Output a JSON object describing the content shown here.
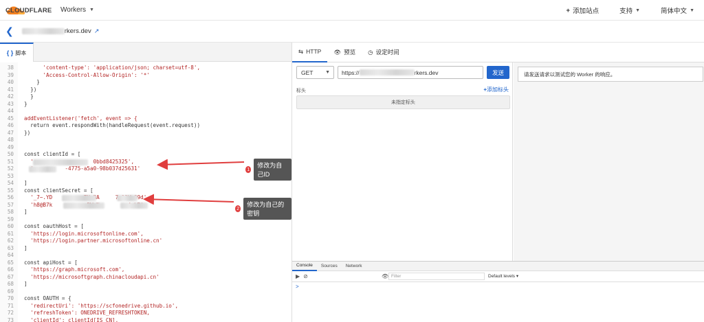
{
  "topbar": {
    "logo_text": "CLOUDFLARE",
    "product_menu": "Workers",
    "add_site": "添加站点",
    "support": "支持",
    "language": "简体中文"
  },
  "subbar": {
    "domain_suffix": "rkers.dev"
  },
  "editor": {
    "tab_label": "脚本",
    "lines": [
      {
        "n": "38",
        "t": "      'content-type': 'application/json; charset=utf-8',"
      },
      {
        "n": "39",
        "t": "      'Access-Control-Allow-Origin': '*'"
      },
      {
        "n": "40",
        "t": "    }"
      },
      {
        "n": "41",
        "t": "  })"
      },
      {
        "n": "42",
        "t": "  }"
      },
      {
        "n": "43",
        "t": "}"
      },
      {
        "n": "44",
        "t": ""
      },
      {
        "n": "45",
        "t": "addEventListener('fetch', event => {"
      },
      {
        "n": "46",
        "t": "  return event.respondWith(handleRequest(event.request))"
      },
      {
        "n": "47",
        "t": "})"
      },
      {
        "n": "48",
        "t": ""
      },
      {
        "n": "49",
        "t": ""
      },
      {
        "n": "50",
        "t": "const clientId = ["
      },
      {
        "n": "51",
        "t": "  '                   0bbd8425325',"
      },
      {
        "n": "52",
        "t": "  '          -4775-a5a0-98b037d25631'"
      },
      {
        "n": "53",
        "t": ""
      },
      {
        "n": "54",
        "t": "]"
      },
      {
        "n": "55",
        "t": "const clientSecret = ["
      },
      {
        "n": "56",
        "t": "  '_7~.YD          TH.BA     7_12W~O9d',"
      },
      {
        "n": "57",
        "t": "  'h8@B7k           BWeN         4yLB'"
      },
      {
        "n": "58",
        "t": "]"
      },
      {
        "n": "59",
        "t": ""
      },
      {
        "n": "60",
        "t": "const oauthHost = ["
      },
      {
        "n": "61",
        "t": "  'https://login.microsoftonline.com',"
      },
      {
        "n": "62",
        "t": "  'https://login.partner.microsoftonline.cn'"
      },
      {
        "n": "63",
        "t": "]"
      },
      {
        "n": "64",
        "t": ""
      },
      {
        "n": "65",
        "t": "const apiHost = ["
      },
      {
        "n": "66",
        "t": "  'https://graph.microsoft.com',"
      },
      {
        "n": "67",
        "t": "  'https://microsoftgraph.chinacloudapi.cn'"
      },
      {
        "n": "68",
        "t": "]"
      },
      {
        "n": "69",
        "t": ""
      },
      {
        "n": "70",
        "t": "const OAUTH = {"
      },
      {
        "n": "71",
        "t": "  'redirectUri': 'https://scfonedrive.github.io',"
      },
      {
        "n": "72",
        "t": "  'refreshToken': ONEDRIVE_REFRESHTOKEN,"
      },
      {
        "n": "73",
        "t": "  'clientId': clientId[IS_CN],"
      }
    ]
  },
  "annotations": [
    {
      "num": "1",
      "text": "修改为自己ID"
    },
    {
      "num": "2",
      "text": "修改为自己的密钥"
    }
  ],
  "right": {
    "tabs": [
      "HTTP",
      "预览",
      "设定时间"
    ],
    "method": "GET",
    "url_prefix": "https://",
    "url_suffix": "rkers.dev",
    "send": "发送",
    "headers_label": "标头",
    "add_header": "添加标头",
    "no_headers": "未指定标头",
    "response_msg": "请发送请求以测试您的 Worker 的响应。"
  },
  "console": {
    "tabs": [
      "Console",
      "Sources",
      "Network"
    ],
    "filter_placeholder": "Filter",
    "levels": "Default levels ▾",
    "prompt": ">"
  },
  "colors": {
    "accent": "#2266cc",
    "logo_orange": "#f38020",
    "annotation_red": "#e03e3e"
  }
}
